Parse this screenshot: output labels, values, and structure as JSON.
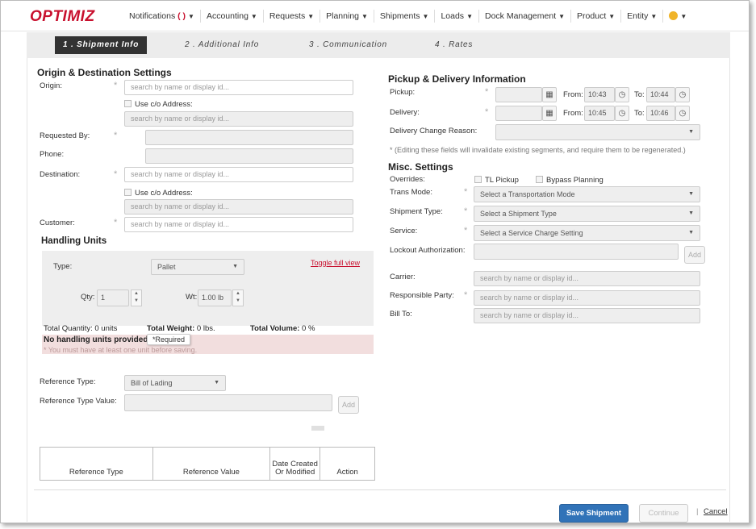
{
  "nav": {
    "logo": "OPTIMIZ",
    "items": [
      {
        "label": "Notifications",
        "badge": "( )"
      },
      {
        "label": "Accounting"
      },
      {
        "label": "Requests"
      },
      {
        "label": "Planning"
      },
      {
        "label": "Shipments"
      },
      {
        "label": "Loads"
      },
      {
        "label": "Dock Management"
      },
      {
        "label": "Product"
      },
      {
        "label": "Entity"
      }
    ],
    "caret": "▼"
  },
  "steps": [
    {
      "label": "1 . Shipment Info",
      "active": true
    },
    {
      "label": "2 . Additional Info"
    },
    {
      "label": "3 . Communication"
    },
    {
      "label": "4 . Rates"
    }
  ],
  "origin_dest": {
    "title": "Origin & Destination Settings",
    "origin_label": "Origin:",
    "origin_placeholder": "search by name or display id...",
    "use_co_label": "Use c/o Address:",
    "co_placeholder": "search by name or display id...",
    "requested_by_label": "Requested By:",
    "phone_label": "Phone:",
    "destination_label": "Destination:",
    "destination_placeholder": "search by name or display id...",
    "dest_use_co_label": "Use c/o Address:",
    "dest_co_placeholder": "search by name or display id...",
    "customer_label": "Customer:",
    "customer_placeholder": "search by name or display id...",
    "required_mark": "*"
  },
  "handling": {
    "title": "Handling Units",
    "type_label": "Type:",
    "type_value": "Pallet",
    "toggle_label": "Toggle full view",
    "qty_label": "Qty:",
    "qty_value": "1",
    "wt_label": "Wt:",
    "wt_value": "1.00 lb",
    "total_qty": "Total Quantity: 0 units",
    "total_weight_label": "Total Weight:",
    "total_weight_value": "0 lbs.",
    "total_volume_label": "Total Volume:",
    "total_volume_value": "0 %",
    "error_title": "No handling units provided.",
    "error_tooltip": "*Required",
    "error_note": "* You must have at least one unit before saving."
  },
  "reference": {
    "type_label": "Reference Type:",
    "type_value": "Bill of Lading",
    "value_label": "Reference Type Value:",
    "add_label": "Add",
    "table_headers": [
      "Reference Type",
      "Reference Value",
      "Date Created Or Modified",
      "Action"
    ]
  },
  "pickup": {
    "title": "Pickup & Delivery Information",
    "pickup_label": "Pickup:",
    "delivery_label": "Delivery:",
    "from_label": "From:",
    "to_label": "To:",
    "pickup_from": "10:43",
    "pickup_to": "10:44",
    "delivery_from": "10:45",
    "delivery_to": "10:46",
    "change_reason_label": "Delivery Change Reason:",
    "note": "* (Editing these fields will invalidate existing segments, and require them to be regenerated.)"
  },
  "misc": {
    "title": "Misc. Settings",
    "overrides_label": "Overrides:",
    "tl_pickup_label": "TL Pickup",
    "bypass_label": "Bypass Planning",
    "trans_mode_label": "Trans Mode:",
    "trans_mode_value": "Select a Transportation Mode",
    "shipment_type_label": "Shipment Type:",
    "shipment_type_value": "Select a Shipment Type",
    "service_label": "Service:",
    "service_value": "Select a Service Charge Setting",
    "lockout_label": "Lockout Authorization:",
    "add_label": "Add",
    "carrier_label": "Carrier:",
    "carrier_placeholder": "search by name or display id...",
    "responsible_label": "Responsible Party:",
    "responsible_placeholder": "search by name or display id...",
    "bill_to_label": "Bill To:",
    "bill_to_placeholder": "search by name or display id..."
  },
  "footer": {
    "save_label": "Save Shipment",
    "continue_label": "Continue",
    "separator": "|",
    "cancel_label": "Cancel"
  }
}
